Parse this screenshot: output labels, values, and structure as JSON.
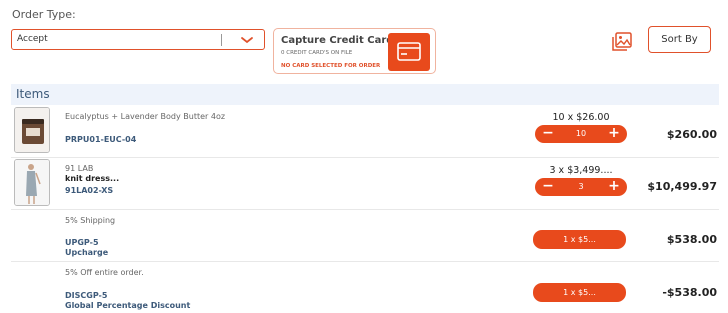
{
  "order_type": {
    "label": "Order Type:",
    "selected": "Accept"
  },
  "capture_card": {
    "title": "Capture Credit Card",
    "subtitle": "0 CREDIT CARD'S ON FILE",
    "warning": "NO CARD SELECTED FOR ORDER"
  },
  "toolbar": {
    "sort_label": "Sort By"
  },
  "items": {
    "title": "Items",
    "lines": [
      {
        "desc": "Eucalyptus + Lavender Body Butter 4oz",
        "name": "",
        "sku": "PRPU01-EUC-04",
        "qty_price": "10 x $26.00",
        "qty": "10",
        "total": "$260.00"
      },
      {
        "desc": "91 LAB",
        "name": "knit dress...",
        "sku": "91LA02-XS",
        "qty_price": "3 x $3,499....",
        "qty": "3",
        "total": "$10,499.97"
      },
      {
        "desc": "5% Shipping",
        "sku": "UPGP-5",
        "sku_desc": "Upcharge",
        "pill": "1 x $5...",
        "total": "$538.00"
      },
      {
        "desc": "5% Off entire order.",
        "sku": "DISCGP-5",
        "sku_desc": "Global Percentage Discount",
        "pill": "1 x $5...",
        "total": "-$538.00"
      }
    ]
  },
  "colors": {
    "accent": "#e84a1c",
    "header_bg": "#eef3fb",
    "link": "#3d5a7a"
  }
}
